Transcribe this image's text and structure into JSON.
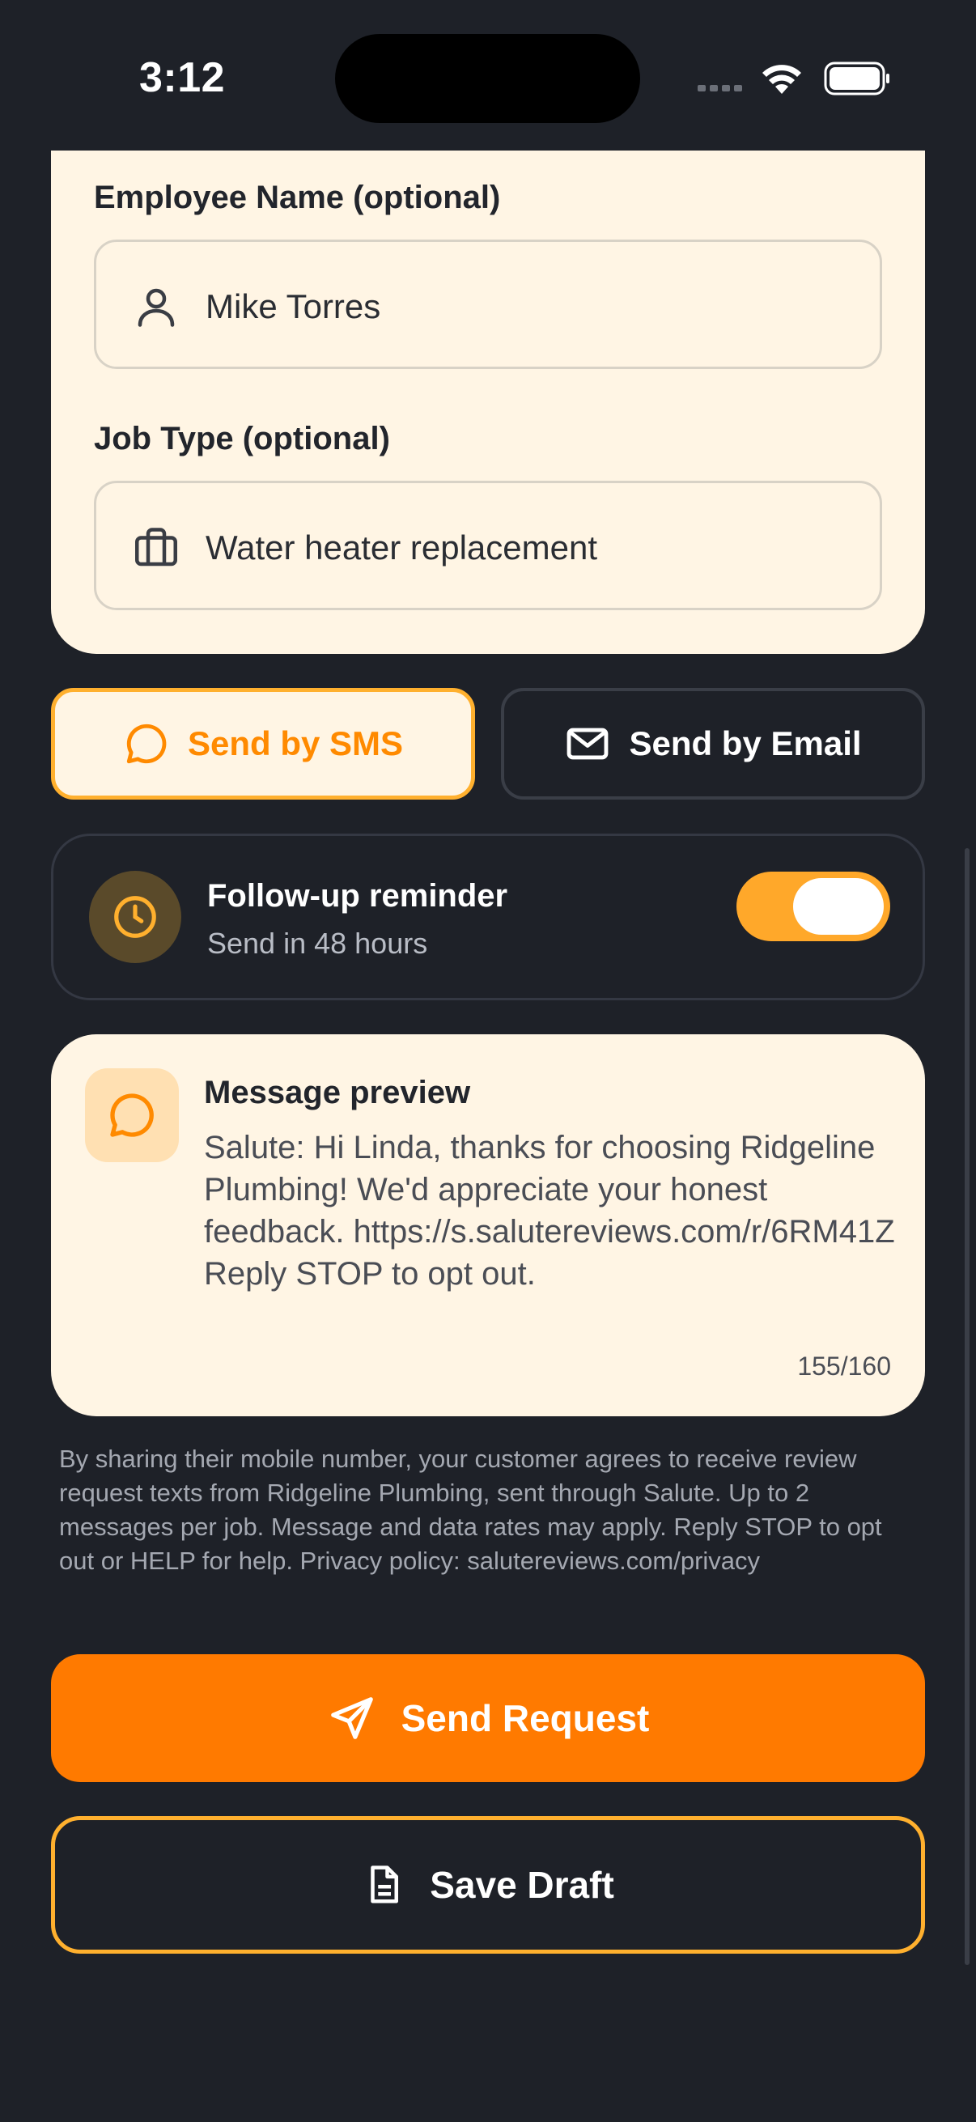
{
  "status_bar": {
    "time": "3:12",
    "icons": [
      "signal-dots-icon",
      "wifi-icon",
      "battery-icon"
    ]
  },
  "form": {
    "employee_label": "Employee Name (optional)",
    "employee_value": "Mike Torres",
    "employee_icon": "person-icon",
    "job_label": "Job Type (optional)",
    "job_value": "Water heater replacement",
    "job_icon": "briefcase-icon"
  },
  "channels": {
    "sms_label": "Send by SMS",
    "email_label": "Send by Email",
    "selected": "sms"
  },
  "reminder": {
    "title": "Follow-up reminder",
    "subtitle": "Send in 48 hours",
    "enabled": true
  },
  "preview": {
    "title": "Message preview",
    "body": "Salute: Hi Linda, thanks for choosing Ridgeline Plumbing! We'd appreciate your honest feedback. https://s.salutereviews.com/r/6RM41Z Reply STOP to opt out.",
    "count": "155/160"
  },
  "disclaimer": "By sharing their mobile number, your customer agrees to receive review request texts from Ridgeline Plumbing, sent through Salute. Up to 2 messages per job. Message and data rates may apply. Reply STOP to opt out or HELP for help. Privacy policy: salutereviews.com/privacy",
  "actions": {
    "send_label": "Send Request",
    "draft_label": "Save Draft"
  },
  "colors": {
    "background": "#1e2128",
    "card": "#fff5e4",
    "accent": "#ff7a00",
    "accent_light": "#ffb02e"
  }
}
